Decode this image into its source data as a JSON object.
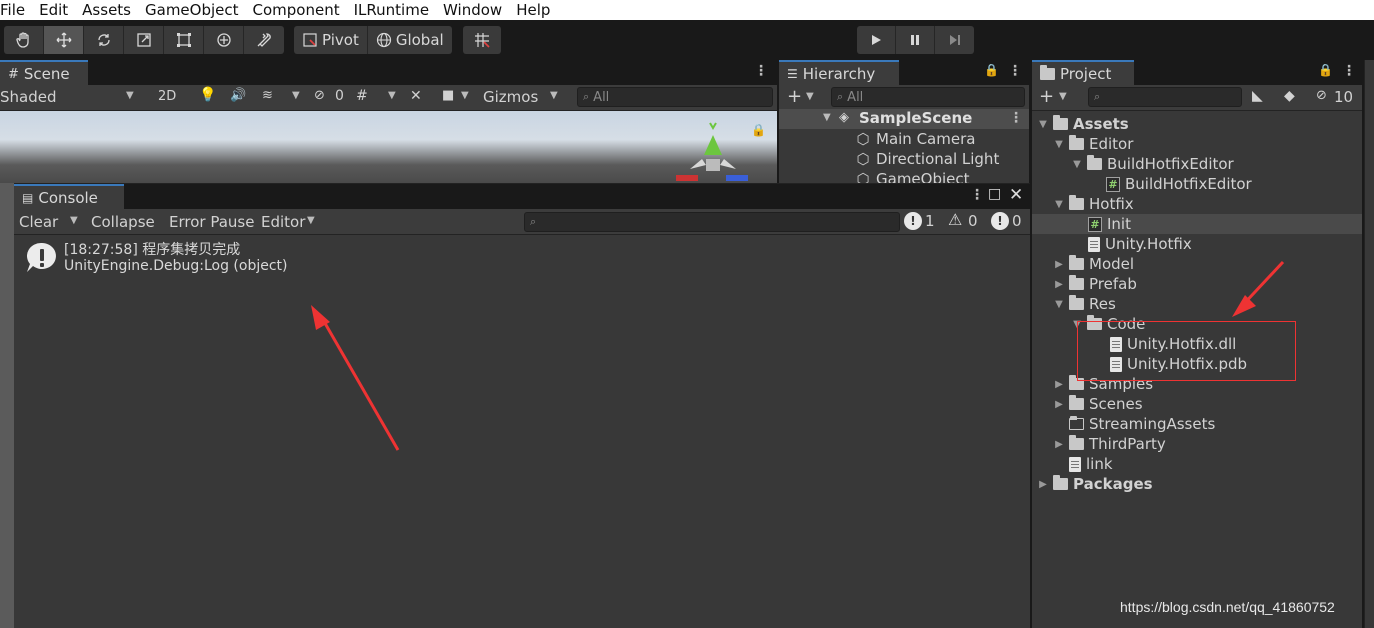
{
  "menu": [
    "File",
    "Edit",
    "Assets",
    "GameObject",
    "Component",
    "ILRuntime",
    "Window",
    "Help"
  ],
  "toolbar": {
    "pivot_label": "Pivot",
    "global_label": "Global"
  },
  "scene": {
    "tab_label": "Scene",
    "shading_mode": "Shaded",
    "mode_2d": "2D",
    "hidden_count": "0",
    "gizmos_label": "Gizmos",
    "search_placeholder": "All"
  },
  "hierarchy": {
    "tab_label": "Hierarchy",
    "search_placeholder": "All",
    "scene_name": "SampleScene",
    "items": [
      "Main Camera",
      "Directional Light",
      "GameObject"
    ]
  },
  "project": {
    "tab_label": "Project",
    "hidden_count": "10",
    "tree": [
      {
        "label": "Assets"
      },
      {
        "label": "Editor"
      },
      {
        "label": "BuildHotfixEditor"
      },
      {
        "label": "BuildHotfixEditor"
      },
      {
        "label": "Hotfix"
      },
      {
        "label": "Init"
      },
      {
        "label": "Unity.Hotfix"
      },
      {
        "label": "Model"
      },
      {
        "label": "Prefab"
      },
      {
        "label": "Res"
      },
      {
        "label": "Code"
      },
      {
        "label": "Unity.Hotfix.dll"
      },
      {
        "label": "Unity.Hotfix.pdb"
      },
      {
        "label": "Samples"
      },
      {
        "label": "Scenes"
      },
      {
        "label": "StreamingAssets"
      },
      {
        "label": "ThirdParty"
      },
      {
        "label": "link"
      },
      {
        "label": "Packages"
      }
    ]
  },
  "console": {
    "tab_label": "Console",
    "clear_label": "Clear",
    "collapse_label": "Collapse",
    "error_pause_label": "Error Pause",
    "editor_label": "Editor",
    "info_count": "1",
    "warning_count": "0",
    "error_count": "0",
    "log_line1": "[18:27:58] 程序集拷贝完成",
    "log_line2": "UnityEngine.Debug:Log (object)"
  },
  "watermark": "https://blog.csdn.net/qq_41860752",
  "colors": {
    "annotation": "#ee3333",
    "selection": "#3a79bb"
  }
}
